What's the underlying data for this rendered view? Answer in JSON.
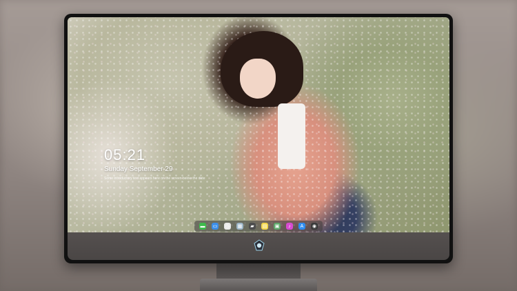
{
  "lockscreen": {
    "time": "05:21",
    "date": "Sunday September  29",
    "subtext": "Some introductory text appears here on the screen below the date"
  },
  "dock": {
    "apps": [
      {
        "name": "messages-icon",
        "color": "#3dbb4b",
        "glyph": "▬"
      },
      {
        "name": "finder-icon",
        "color": "#3b8ee8",
        "glyph": "▭"
      },
      {
        "name": "clock-icon",
        "color": "#e9e9e9",
        "glyph": "◷"
      },
      {
        "name": "preview-icon",
        "color": "#9fb8c9",
        "glyph": "▦"
      },
      {
        "name": "clapper-icon",
        "color": "#4d4d4d",
        "glyph": "▰"
      },
      {
        "name": "notes-icon",
        "color": "#f4d64a",
        "glyph": "▤"
      },
      {
        "name": "photos-icon",
        "color": "#5fa86b",
        "glyph": "▣"
      },
      {
        "name": "music-icon",
        "color": "#d84bd0",
        "glyph": "♪"
      },
      {
        "name": "appstore-icon",
        "color": "#2f8cf0",
        "glyph": "A"
      },
      {
        "name": "camera-icon",
        "color": "#3a3a3a",
        "glyph": "◉"
      }
    ]
  },
  "brand": {
    "logo_icon": "diamond-badge-icon"
  }
}
